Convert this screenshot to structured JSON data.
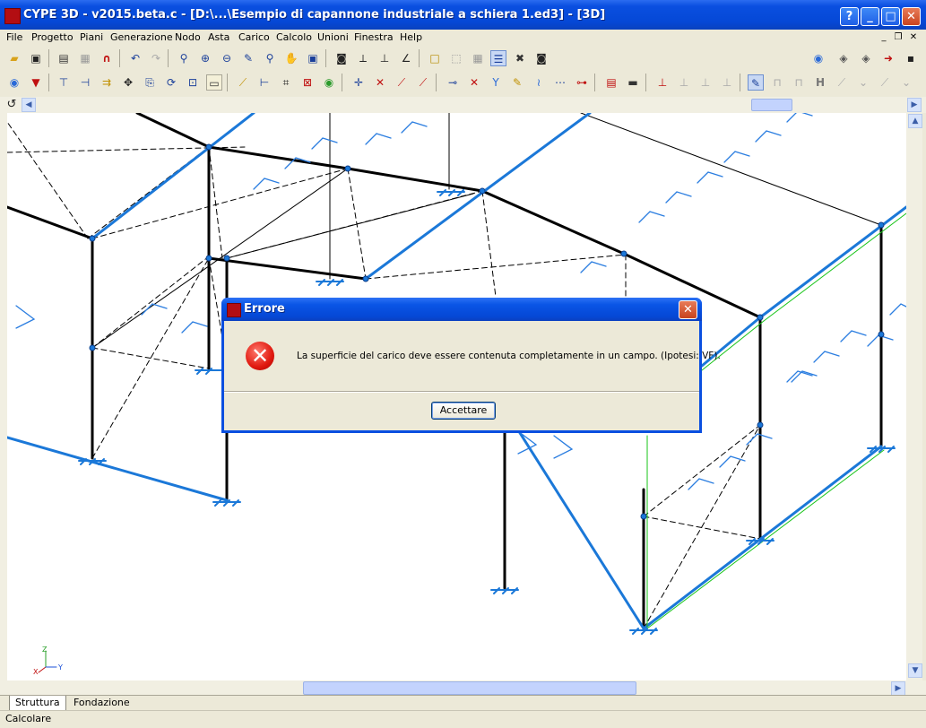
{
  "window": {
    "title": "CYPE 3D - v2015.beta.c - [D:\\...\\Esempio di capannone industriale a schiera 1.ed3] - [3D]",
    "help_label": "?",
    "minimize_label": "_",
    "maximize_label": "□",
    "close_label": "✕"
  },
  "menu": {
    "items": [
      "File",
      "Progetto",
      "Piani",
      "Generazione",
      "Nodo",
      "Asta",
      "Carico",
      "Calcolo",
      "Unioni",
      "Finestra",
      "Help"
    ],
    "mdi_min": "_",
    "mdi_restore": "❐",
    "mdi_close": "✕"
  },
  "tabs": [
    "Struttura",
    "Fondazione"
  ],
  "status": {
    "text": "Calcolare"
  },
  "dialog": {
    "title": "Errore",
    "message": "La superficie del carico deve essere contenuta completamente in un campo. (Ipotesi: VF).",
    "ok_label": "Accettare",
    "close_label": "✕",
    "icon": "error-icon"
  },
  "axes": {
    "z": "Z",
    "x": "X",
    "y": "Y"
  },
  "colors": {
    "titlebar": "#0a4fe0",
    "member": "#000000",
    "beam_blue": "#1b78d8",
    "load_arrow": "#2a7de0",
    "green": "#19c419"
  }
}
